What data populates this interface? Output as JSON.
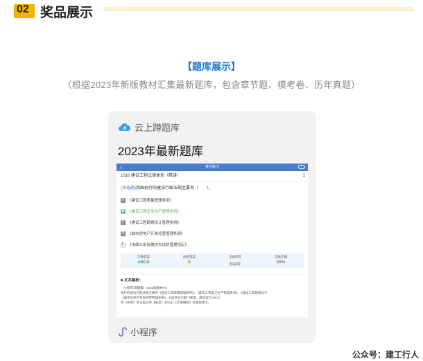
{
  "section": {
    "number": "02",
    "title": "奖品展示"
  },
  "heading": "【题库展示】",
  "subheading": "（根据2023年新版教材汇集最新题库，包含章节题、模考卷、历年真题）",
  "card": {
    "brand": "云上蹲题库",
    "title": "2023年最新题库",
    "mini_label": "小程序",
    "brand_icon": "cloud-icon",
    "mini_icon": "miniprogram-icon"
  },
  "screenshot": {
    "bar_title": "章节练习",
    "back_icon": "chevron-left-icon",
    "menu_icon": "capsule-menu-icon",
    "chapter": "1010 建设工程法律体系（精讲）",
    "page": "1",
    "question_tag": "(多选题)",
    "question_text": "我国现行的建设行政法规主要有（　　）。",
    "options": [
      {
        "letter": "A",
        "text": "《建设工程质量管理条例》",
        "correct": false
      },
      {
        "letter": "B",
        "text": "《建设工程安全生产管理条例》",
        "correct": true
      },
      {
        "letter": "C",
        "text": "《建设工程勘察设计管理条例》",
        "correct": false
      },
      {
        "letter": "D",
        "text": "《城市房地产开发经营管理条例》",
        "correct": false
      },
      {
        "letter": "E",
        "text": "《市政公用设施抗灾设防管理规定》",
        "correct": false
      }
    ],
    "stats": [
      {
        "label": "正确答案",
        "value": "ABCD",
        "tone": "green"
      },
      {
        "label": "你的答案",
        "value": "B",
        "tone": "orange"
      },
      {
        "label": "全站作答",
        "value": "814次",
        "tone": "plain"
      },
      {
        "label": "全站正确",
        "value": "59%",
        "tone": "plain"
      }
    ],
    "analysis_title": "■ 文本解析：",
    "analysis_body": "（小程序:蹲题库）2023版教材P3\n现行的建设行政法规主要有《建设工程质量管理条例》、《建设工程安全生产管理条例》、《建设工程勘察设计\n《城市房地产开发经营管理条例》，E选项应为部门规章。故答案为ABCD\n带【条例】的法规比带【规定】【办法】【实施细则】的规章要大。"
  },
  "footer": "公众号：建工行人",
  "colors": {
    "accent": "#f2b400",
    "link_blue": "#1e78d6",
    "card_bg": "#f2f2f2",
    "bar_blue": "#4a7cc9"
  }
}
